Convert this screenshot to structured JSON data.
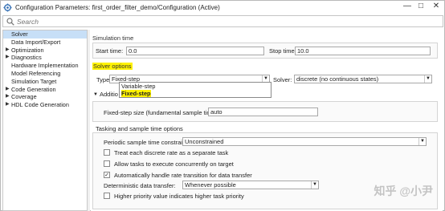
{
  "window": {
    "title": "Configuration Parameters: first_order_filter_demo/Configuration (Active)"
  },
  "search": {
    "placeholder": "Search"
  },
  "tree": {
    "items": [
      {
        "label": "Solver",
        "selected": true,
        "expandable": false
      },
      {
        "label": "Data Import/Export",
        "expandable": false
      },
      {
        "label": "Optimization",
        "expandable": true
      },
      {
        "label": "Diagnostics",
        "expandable": true
      },
      {
        "label": "Hardware Implementation",
        "expandable": false
      },
      {
        "label": "Model Referencing",
        "expandable": false
      },
      {
        "label": "Simulation Target",
        "expandable": false
      },
      {
        "label": "Code Generation",
        "expandable": true
      },
      {
        "label": "Coverage",
        "expandable": true
      },
      {
        "label": "HDL Code Generation",
        "expandable": true
      }
    ]
  },
  "simulation_time": {
    "title": "Simulation time",
    "start_label": "Start time:",
    "start_value": "0.0",
    "stop_label": "Stop time:",
    "stop_value": "10.0"
  },
  "solver_options": {
    "title": "Solver options",
    "type_label": "Type:",
    "type_value": "Fixed-step",
    "solver_label": "Solver:",
    "solver_value": "discrete (no continuous states)",
    "dropdown_options": [
      "Variable-step",
      "Fixed-step"
    ],
    "additional_label": "Additio",
    "fixed_step_label": "Fixed-step size (fundamental sample time):",
    "fixed_step_value": "auto"
  },
  "tasking": {
    "title": "Tasking and sample time options",
    "periodic_label": "Periodic sample time constraint:",
    "periodic_value": "Unconstrained",
    "checkboxes": [
      {
        "label": "Treat each discrete rate as a separate task",
        "checked": false
      },
      {
        "label": "Allow tasks to execute concurrently on target",
        "checked": false
      },
      {
        "label": "Automatically handle rate transition for data transfer",
        "checked": true
      }
    ],
    "deterministic_label": "Deterministic data transfer:",
    "deterministic_value": "Whenever possible",
    "priority_label": "Higher priority value indicates higher task priority",
    "priority_checked": false
  },
  "watermark": "知乎 @小尹",
  "colors": {
    "highlight": "#fff200",
    "selected": "#c7dff7",
    "accent": "#0072bd"
  }
}
